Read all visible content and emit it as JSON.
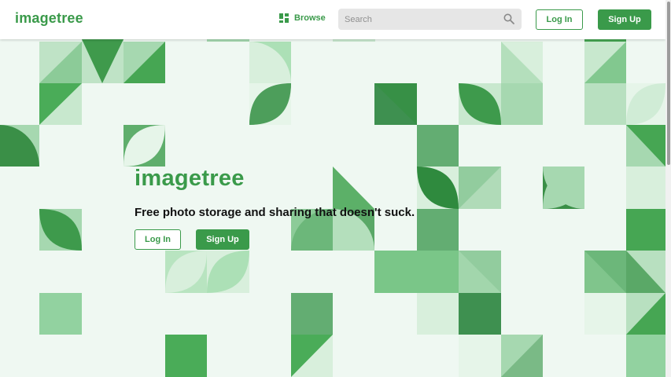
{
  "header": {
    "logo": "imagetree",
    "browse_label": "Browse",
    "search_placeholder": "Search",
    "login_label": "Log In",
    "signup_label": "Sign Up"
  },
  "hero": {
    "title": "imagetree",
    "tagline": "Free photo storage and sharing that doesn't suck.",
    "login_label": "Log In",
    "signup_label": "Sign Up"
  },
  "colors": {
    "accent": "#3a9a4a",
    "background": "#eff8f2"
  },
  "icons": {
    "browse": "grid-icon",
    "search": "search-icon"
  }
}
